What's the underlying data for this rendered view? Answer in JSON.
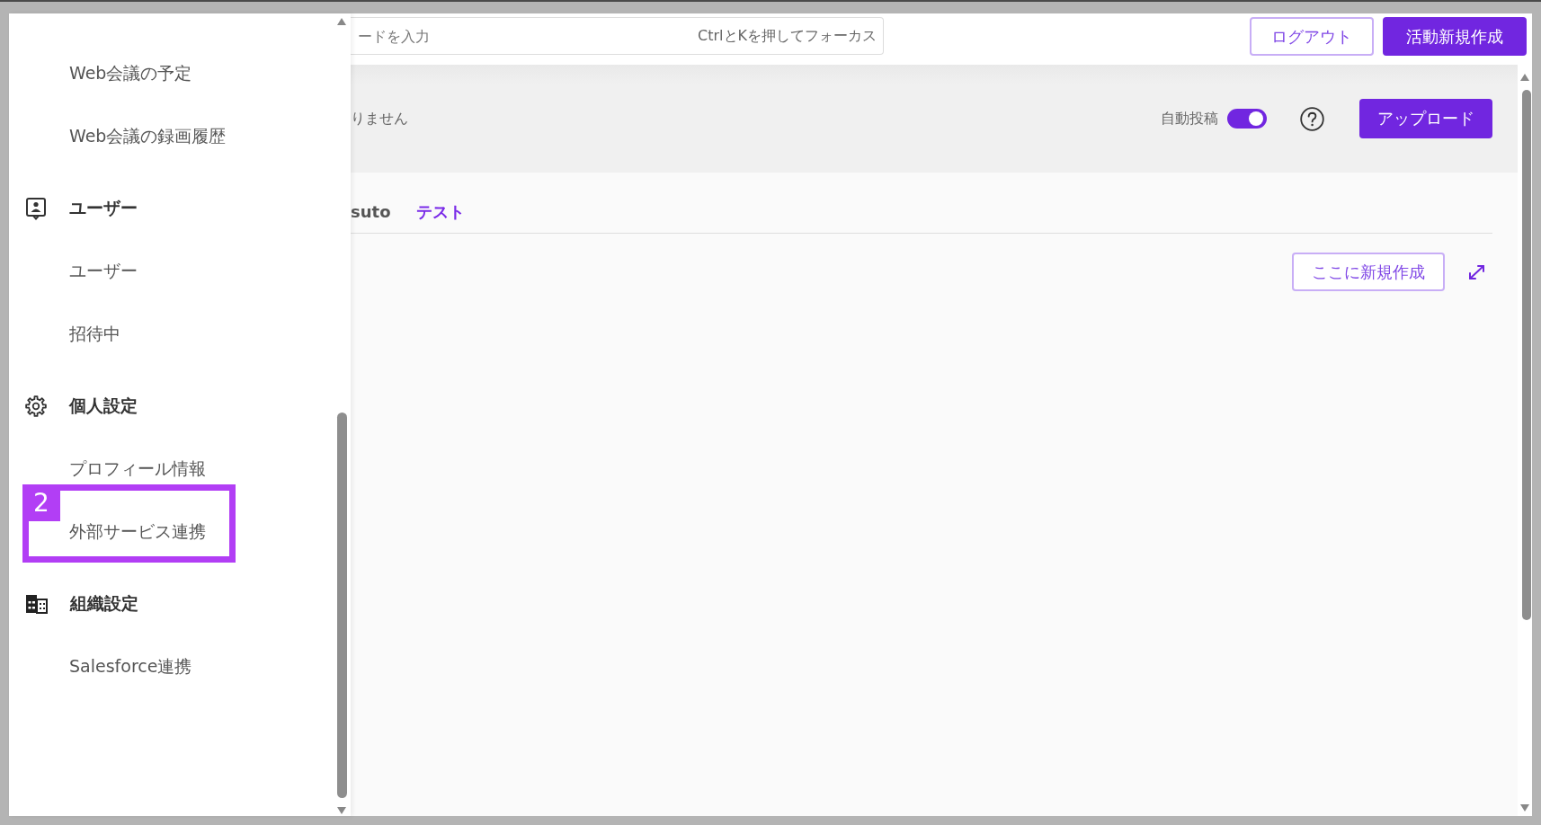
{
  "sidebar": {
    "groups": [
      {
        "items": [
          {
            "label": "Web会議の予定"
          },
          {
            "label": "Web会議の録画履歴"
          }
        ]
      },
      {
        "title": "ユーザー",
        "items": [
          {
            "label": "ユーザー"
          },
          {
            "label": "招待中"
          }
        ]
      },
      {
        "title": "個人設定",
        "items": [
          {
            "label": "プロフィール情報"
          },
          {
            "label": "外部サービス連携",
            "callout": "2"
          }
        ]
      },
      {
        "title": "組織設定",
        "items": [
          {
            "label": "Salesforce連携"
          }
        ]
      }
    ]
  },
  "top_bar": {
    "search": {
      "placeholder": "ードを入力",
      "shortcut_hint": "CtrlとKを押してフォーカス"
    },
    "buttons": [
      {
        "label": "ログアウト",
        "kind": "outline"
      },
      {
        "label": "活動新規作成",
        "kind": "primary"
      }
    ]
  },
  "toolbar": {
    "message": "りません",
    "auto_post": {
      "label": "自動投稿",
      "on": true
    },
    "upload_button": "アップロード"
  },
  "tabs": [
    {
      "label": "suto",
      "selected": false
    },
    {
      "label": "テスト",
      "selected": true
    }
  ],
  "tab_panel": {
    "create_button": "ここに新規作成"
  }
}
